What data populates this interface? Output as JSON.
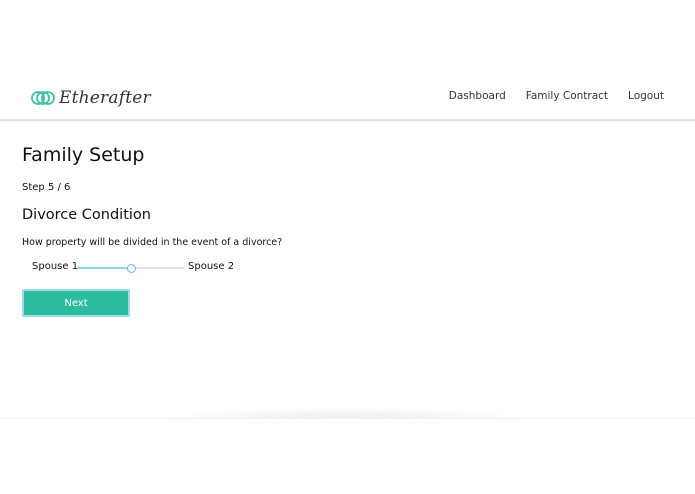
{
  "brand": {
    "name": "Etherafter"
  },
  "nav": {
    "links": [
      "Dashboard",
      "Family Contract",
      "Logout"
    ]
  },
  "page": {
    "title": "Family Setup",
    "step": "Step 5 / 6",
    "section_title": "Divorce Condition",
    "question": "How property will be divided in the event of a divorce?"
  },
  "slider": {
    "left_label": "Spouse 1",
    "right_label": "Spouse 2",
    "value_fraction": 0.5
  },
  "actions": {
    "next_label": "Next"
  },
  "colors": {
    "accent": "#2bbd9e",
    "button_border": "#9fd9ee",
    "slider_fill": "#8fd3ef",
    "slider_thumb_border": "#5bbde6"
  }
}
